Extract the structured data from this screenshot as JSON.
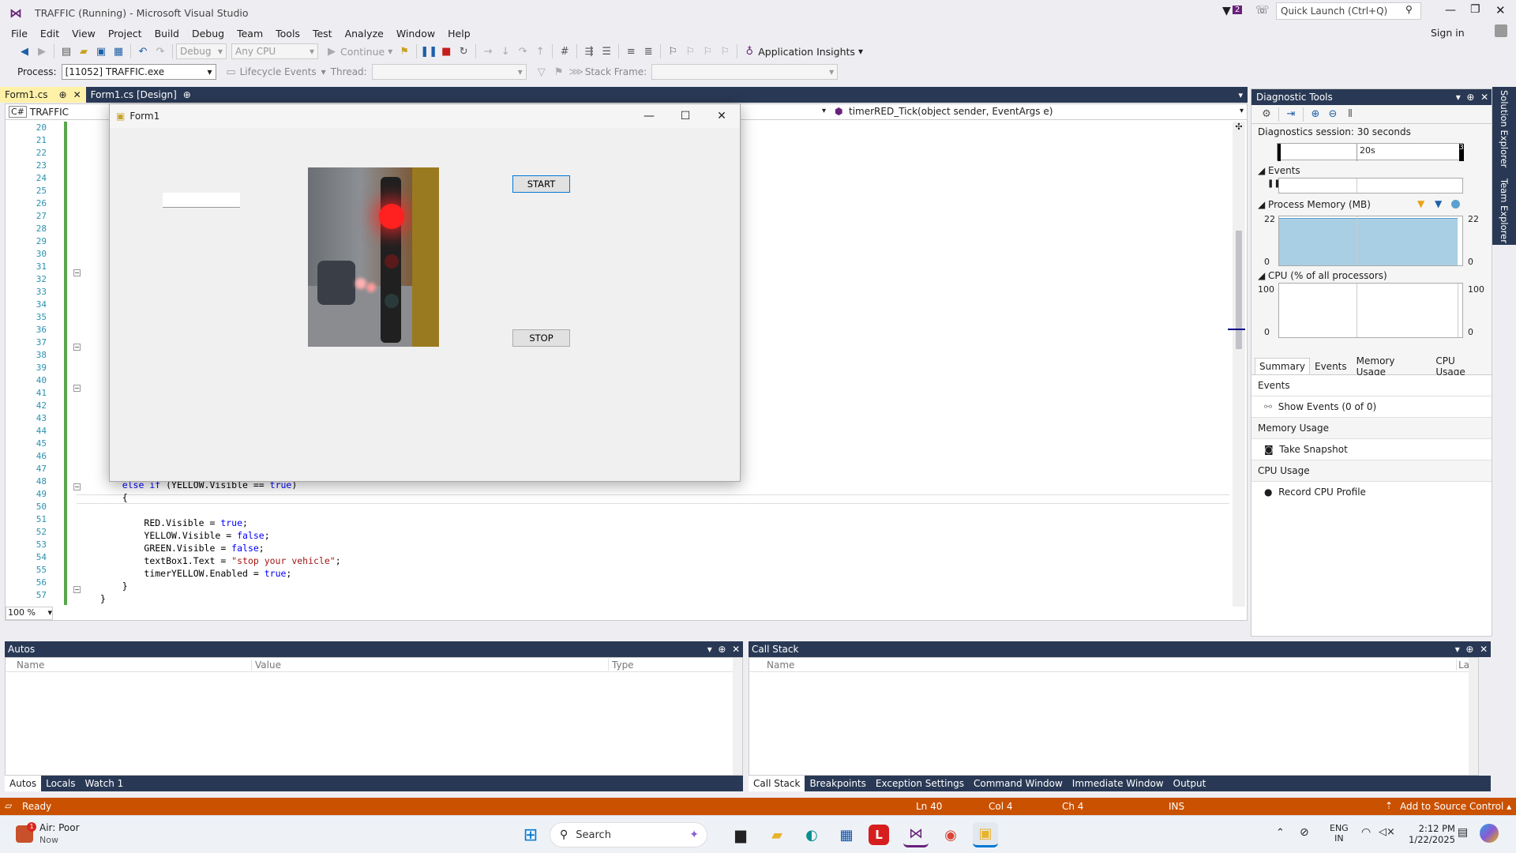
{
  "window": {
    "title": "TRAFFIC (Running) - Microsoft Visual Studio",
    "notifications": "2",
    "quick_launch": "Quick Launch (Ctrl+Q)",
    "sign_in": "Sign in"
  },
  "menu": [
    "File",
    "Edit",
    "View",
    "Project",
    "Build",
    "Debug",
    "Team",
    "Tools",
    "Test",
    "Analyze",
    "Window",
    "Help"
  ],
  "toolbar": {
    "config": "Debug",
    "platform": "Any CPU",
    "continue": "Continue",
    "insights": "Application Insights"
  },
  "debugbar": {
    "process_label": "Process:",
    "process_value": "[11052] TRAFFIC.exe",
    "lifecycle": "Lifecycle Events",
    "thread_label": "Thread:",
    "stack_label": "Stack Frame:"
  },
  "tabs": [
    {
      "label": "Form1.cs"
    },
    {
      "label": "Form1.cs [Design]"
    }
  ],
  "editor": {
    "project": "TRAFFIC",
    "method": "timerRED_Tick(object sender, EventArgs e)",
    "zoom": "100 %",
    "line_numbers": [
      "20",
      "21",
      "22",
      "23",
      "24",
      "25",
      "26",
      "27",
      "28",
      "29",
      "30",
      "31",
      "32",
      "33",
      "34",
      "35",
      "36",
      "37",
      "38",
      "39",
      "40",
      "41",
      "42",
      "43",
      "44",
      "45",
      "46",
      "47",
      "48",
      "49",
      "50",
      "51",
      "52",
      "53",
      "54",
      "55",
      "56",
      "57"
    ],
    "code": {
      "l47a": "else if",
      "l47b": " (YELLOW.Visible == ",
      "l47c": "true",
      "l47d": ")",
      "l48": "{",
      "l50a": "RED.Visible = ",
      "l50b": "true",
      "l50c": ";",
      "l51a": "YELLOW.Visible = ",
      "l51b": "false",
      "l51c": ";",
      "l52a": "GREEN.Visible = ",
      "l52b": "false",
      "l52c": ";",
      "l53a": "textBox1.Text = ",
      "l53b": "\"stop your vehicle\"",
      "l53c": ";",
      "l54a": "timerYELLOW.Enabled = ",
      "l54b": "true",
      "l54c": ";",
      "l55": "}",
      "l56": "}"
    }
  },
  "form1": {
    "title": "Form1",
    "start": "START",
    "stop": "STOP",
    "textbox_value": ""
  },
  "diag": {
    "title": "Diagnostic Tools",
    "session": "Diagnostics session: 30 seconds",
    "timeline_label": "20s",
    "timeline_end": "3",
    "events": "Events",
    "memory": "Process Memory (MB)",
    "mem_max": "22",
    "mem_min": "0",
    "cpu": "CPU (% of all processors)",
    "cpu_max": "100",
    "cpu_min": "0",
    "tabs": [
      "Summary",
      "Events",
      "Memory Usage",
      "CPU Usage"
    ],
    "sec_events": "Events",
    "show_events": "Show Events (0 of 0)",
    "sec_memory": "Memory Usage",
    "take_snapshot": "Take Snapshot",
    "sec_cpu": "CPU Usage",
    "record_cpu": "Record CPU Profile"
  },
  "side": [
    "Solution Explorer",
    "Team Explorer"
  ],
  "autos": {
    "title": "Autos",
    "cols": [
      "Name",
      "Value",
      "Type"
    ],
    "tabs": [
      "Autos",
      "Locals",
      "Watch 1"
    ]
  },
  "callstack": {
    "title": "Call Stack",
    "cols": [
      "Name",
      "Lang"
    ],
    "tabs": [
      "Call Stack",
      "Breakpoints",
      "Exception Settings",
      "Command Window",
      "Immediate Window",
      "Output"
    ]
  },
  "status": {
    "ready": "Ready",
    "ln": "Ln 40",
    "col": "Col 4",
    "ch": "Ch 4",
    "ins": "INS",
    "source": "Add to Source Control"
  },
  "taskbar": {
    "weather_title": "Air: Poor",
    "weather_sub": "Now",
    "weather_badge": "1",
    "search": "Search",
    "lang1": "ENG",
    "lang2": "IN",
    "time": "2:12 PM",
    "date": "1/22/2025"
  },
  "colors": {
    "accent": "#ca5100",
    "panel": "#293955",
    "tab_active": "#fff1a8"
  }
}
